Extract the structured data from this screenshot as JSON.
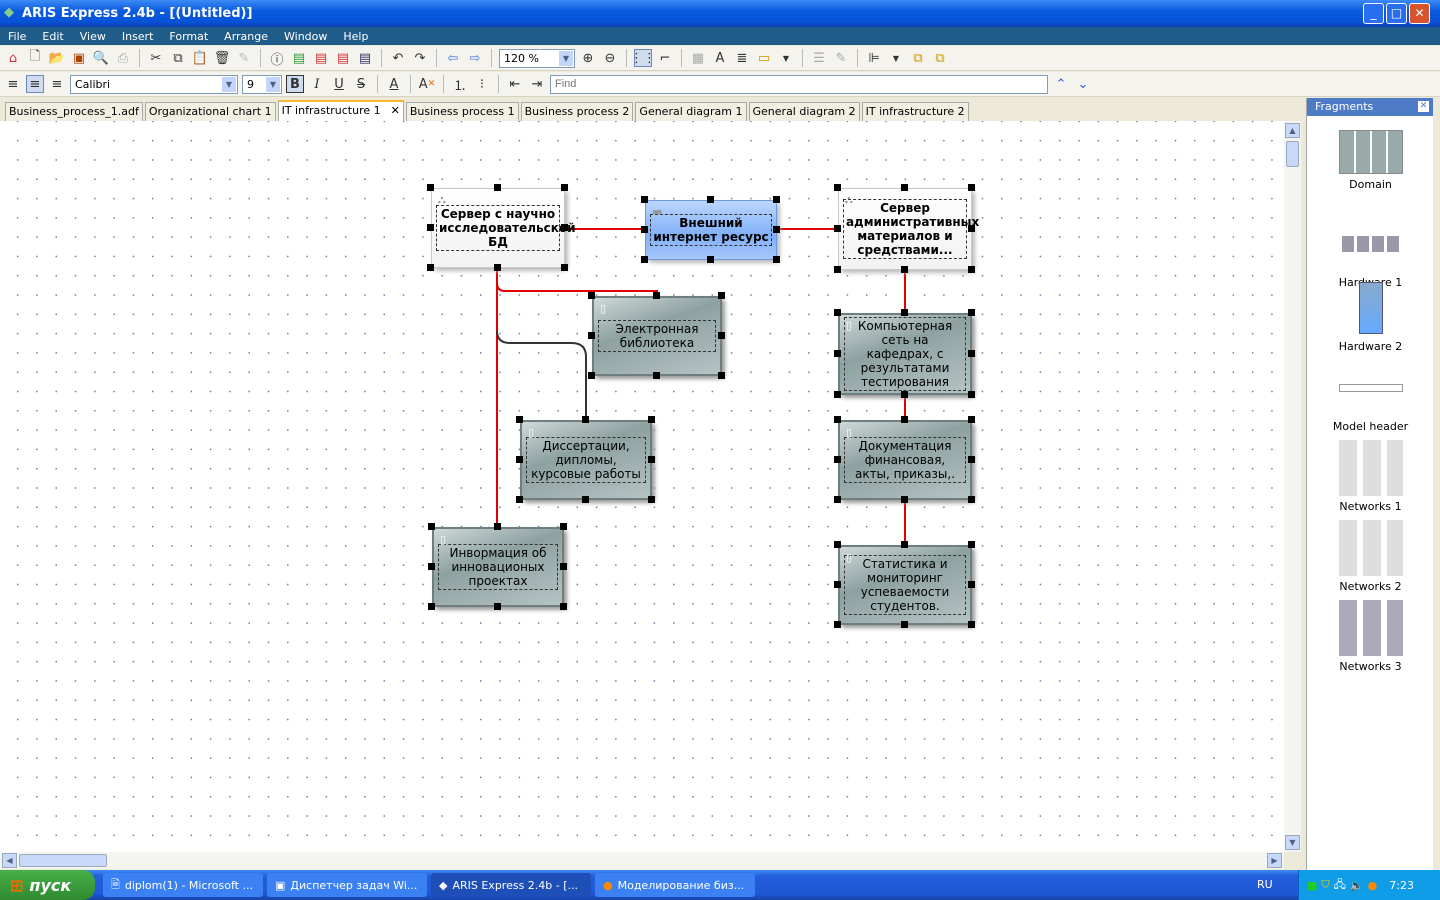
{
  "window": {
    "title": "ARIS Express 2.4b - [(Untitled)]"
  },
  "menu": [
    "File",
    "Edit",
    "View",
    "Insert",
    "Format",
    "Arrange",
    "Window",
    "Help"
  ],
  "toolbar": {
    "zoom": "120 %",
    "font": "Calibri",
    "font_size": "9",
    "find_placeholder": "Find"
  },
  "tabs": [
    {
      "label": "Business_process_1.adf"
    },
    {
      "label": "Organizational chart 1"
    },
    {
      "label": "IT infrastructure 1",
      "active": true
    },
    {
      "label": "Business process 1"
    },
    {
      "label": "Business process 2"
    },
    {
      "label": "General diagram 1"
    },
    {
      "label": "General diagram 2"
    },
    {
      "label": "IT infrastructure 2"
    }
  ],
  "diagram": {
    "nodes": [
      {
        "id": "n1",
        "label": "Сервер с научно исследовательской БД",
        "style": "white",
        "icon": "network-icon"
      },
      {
        "id": "n2",
        "label": "Внешний интернет ресурс",
        "style": "blue",
        "icon": "server-rack-icon"
      },
      {
        "id": "n3",
        "label": "Сервер административных материалов и средствами...",
        "style": "white",
        "icon": "network-icon"
      },
      {
        "id": "n4",
        "label": "Электронная библиотека",
        "style": "gray",
        "icon": "hardware-icon"
      },
      {
        "id": "n5",
        "label": "Компьютерная сеть на кафедрах, с результатами тестирования",
        "style": "gray",
        "icon": "hardware-icon"
      },
      {
        "id": "n6",
        "label": "Диссертации, дипломы, курсовые работы",
        "style": "gray",
        "icon": "hardware-icon"
      },
      {
        "id": "n7",
        "label": "Документация финансовая, акты, приказы,.",
        "style": "gray",
        "icon": "hardware-icon"
      },
      {
        "id": "n8",
        "label": "Инвормация об инновационых проектах",
        "style": "gray",
        "icon": "hardware-icon"
      },
      {
        "id": "n9",
        "label": "Статистика и мониторинг успеваемости студентов.",
        "style": "gray",
        "icon": "hardware-icon"
      }
    ],
    "edge_color": "#e00000"
  },
  "fragments": {
    "title": "Fragments",
    "items": [
      "Domain",
      "Hardware 1",
      "Hardware 2",
      "Model header",
      "Networks 1",
      "Networks 2",
      "Networks 3"
    ]
  },
  "taskbar": {
    "start": "пуск",
    "tasks": [
      "diplom(1) - Microsoft ...",
      "Диспетчер задач Wi...",
      "ARIS Express 2.4b - [...",
      "Моделирование биз..."
    ],
    "lang": "RU",
    "clock": "7:23"
  }
}
